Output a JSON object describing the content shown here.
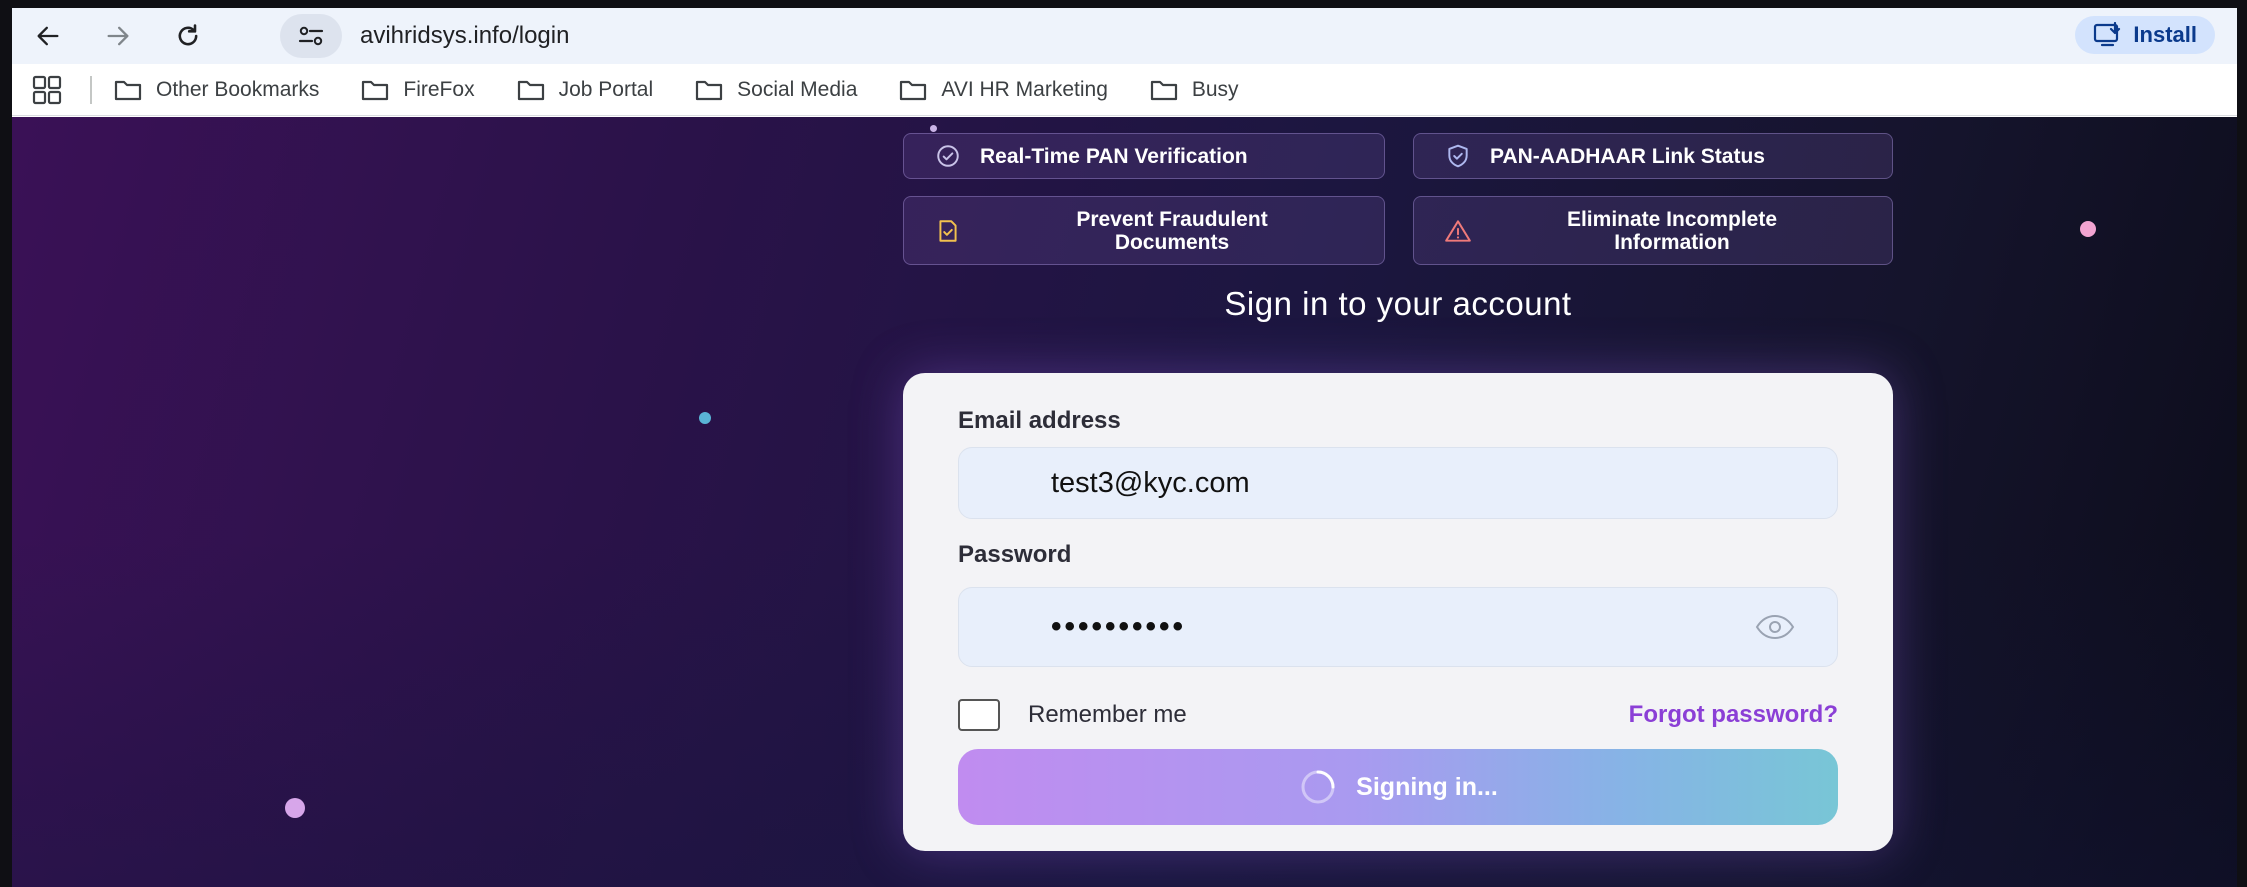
{
  "browser": {
    "url": "avihridsys.info/login",
    "install_label": "Install",
    "icons": [
      "back-arrow-icon",
      "forward-arrow-icon",
      "reload-icon",
      "site-settings-icon",
      "install-app-icon"
    ]
  },
  "bookmarks": {
    "items": [
      {
        "label": "Other Bookmarks"
      },
      {
        "label": "FireFox"
      },
      {
        "label": "Job Portal"
      },
      {
        "label": "Social Media"
      },
      {
        "label": "AVI HR Marketing"
      },
      {
        "label": "Busy"
      }
    ]
  },
  "features": [
    {
      "label": "Real-Time PAN Verification",
      "icon": "check-circle-icon"
    },
    {
      "label": "PAN-AADHAAR Link Status",
      "icon": "shield-check-icon"
    },
    {
      "label": "Prevent Fraudulent Documents",
      "icon": "document-check-icon"
    },
    {
      "label": "Eliminate Incomplete Information",
      "icon": "warning-triangle-icon"
    }
  ],
  "login": {
    "title": "Sign in to your account",
    "email_label": "Email address",
    "email_value": "test3@kyc.com",
    "password_label": "Password",
    "password_value": "••••••••••",
    "remember_label": "Remember me",
    "remember_checked": false,
    "forgot_label": "Forgot password?",
    "submit_label": "Signing in..."
  },
  "colors": {
    "accent": "#8b3fd6",
    "button_gradient_start": "#c08cf0",
    "button_gradient_end": "#78c6d6",
    "page_bg_dark": "#1c1640"
  }
}
